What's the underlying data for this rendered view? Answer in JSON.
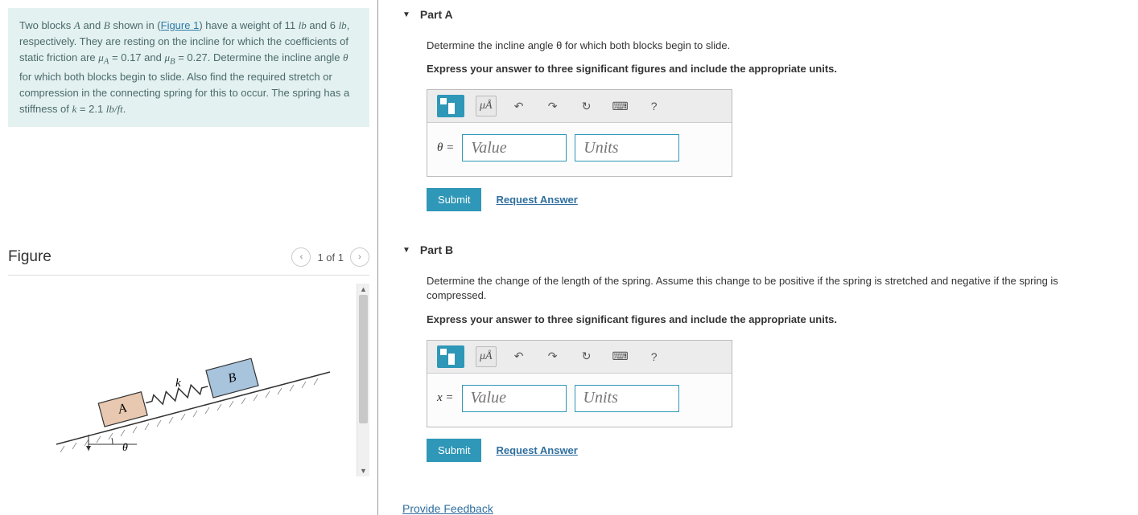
{
  "problem": {
    "text_parts": {
      "p1": "Two blocks ",
      "A": "A",
      "p2": " and ",
      "B": "B",
      "p3": " shown in (",
      "fig_link": "Figure 1",
      "p4": ") have a weight of 11 ",
      "lb1": "lb",
      "p5": " and 6 ",
      "lb2": "lb",
      "p6": ", respectively. They are resting on the incline for which the coefficients of static friction are ",
      "muA": "μ",
      "muA_sub": "A",
      "p7": " = 0.17 and ",
      "muB": "μ",
      "muB_sub": "B",
      "p8": " = 0.27. Determine the incline angle ",
      "theta": "θ",
      "p9": " for which both blocks begin to slide. Also find the required stretch or compression in the connecting spring for this to occur. The spring has a stiffness of ",
      "k": "k",
      "p10": " = 2.1 ",
      "lbft": "lb/ft",
      "p11": "."
    }
  },
  "figure": {
    "title": "Figure",
    "pager": "1 of 1",
    "labels": {
      "A": "A",
      "B": "B",
      "k": "k",
      "theta": "θ"
    }
  },
  "partA": {
    "header": "Part A",
    "prompt": "Determine the incline angle θ for which both blocks begin to slide.",
    "instruction": "Express your answer to three significant figures and include the appropriate units.",
    "var": "θ =",
    "value_placeholder": "Value",
    "units_placeholder": "Units",
    "submit": "Submit",
    "request": "Request Answer",
    "mua_label": "μÅ",
    "help": "?"
  },
  "partB": {
    "header": "Part B",
    "prompt": "Determine the change of the length of the spring. Assume this change to be positive if the spring is stretched and negative if the spring is compressed.",
    "instruction": "Express your answer to three significant figures and include the appropriate units.",
    "var": "x =",
    "value_placeholder": "Value",
    "units_placeholder": "Units",
    "submit": "Submit",
    "request": "Request Answer",
    "mua_label": "μÅ",
    "help": "?"
  },
  "feedback": "Provide Feedback"
}
